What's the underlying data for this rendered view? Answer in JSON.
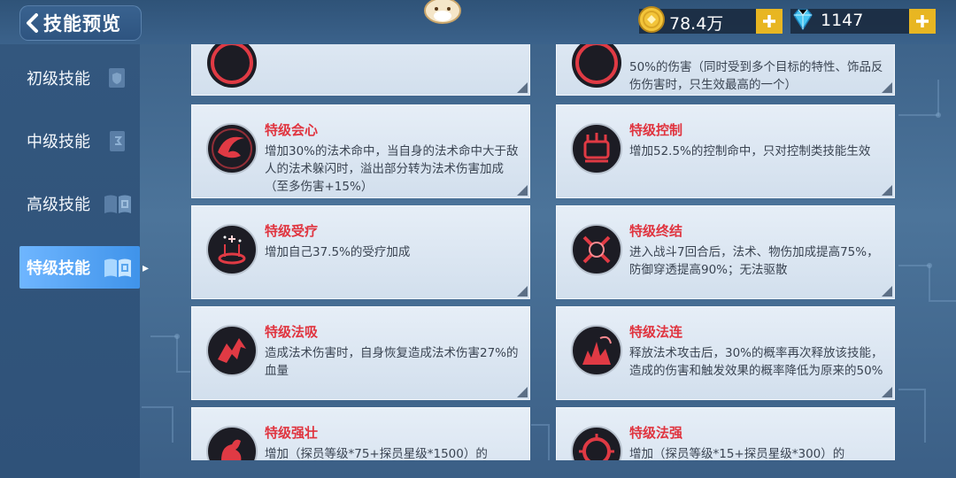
{
  "header": {
    "title": "技能预览",
    "gold": {
      "value": "78.4万",
      "icon": "gold-coin-icon"
    },
    "diamond": {
      "value": "1147",
      "icon": "diamond-icon"
    }
  },
  "sidebar": {
    "items": [
      {
        "label": "初级技能",
        "icon": "shield-tome-icon",
        "active": false
      },
      {
        "label": "中级技能",
        "icon": "scroll-icon",
        "active": false
      },
      {
        "label": "高级技能",
        "icon": "open-book-icon",
        "active": false
      },
      {
        "label": "特级技能",
        "icon": "open-book-icon",
        "active": true
      }
    ]
  },
  "skills": {
    "left": [
      {
        "name": "",
        "desc": "",
        "icon": "skill-emblem-icon"
      },
      {
        "name": "特级会心",
        "desc": "增加30%的法术命中，当自身的法术命中大于敌人的法术躲闪时，溢出部分转为法术伤害加成（至多伤害+15%）",
        "icon": "crit-emblem-icon"
      },
      {
        "name": "特级受疗",
        "desc": "增加自己37.5%的受疗加成",
        "icon": "heal-emblem-icon"
      },
      {
        "name": "特级法吸",
        "desc": "造成法术伤害时，自身恢复造成法术伤害27%的血量",
        "icon": "drain-emblem-icon"
      },
      {
        "name": "特级强壮",
        "desc": "增加（探员等级*75+探员星级*1500）的",
        "icon": "strength-emblem-icon"
      }
    ],
    "right": [
      {
        "name": "",
        "desc": "50%的伤害（同时受到多个目标的特性、饰品反伤伤害时，只生效最高的一个）",
        "icon": "skill-emblem-icon"
      },
      {
        "name": "特级控制",
        "desc": "增加52.5%的控制命中，只对控制类技能生效",
        "icon": "control-emblem-icon"
      },
      {
        "name": "特级终结",
        "desc": "进入战斗7回合后，法术、物伤加成提高75%，防御穿透提高90%；无法驱散",
        "icon": "finish-emblem-icon"
      },
      {
        "name": "特级法连",
        "desc": "释放法术攻击后，30%的概率再次释放该技能，造成的伤害和触发效果的概率降低为原来的50%",
        "icon": "combo-emblem-icon"
      },
      {
        "name": "特级法强",
        "desc": "增加（探员等级*15+探员星级*300）的",
        "icon": "power-emblem-icon"
      }
    ]
  },
  "colors": {
    "accent_red": "#e0343f",
    "gold_button": "#e8b622",
    "sidebar_active": "#4a9cf0"
  }
}
